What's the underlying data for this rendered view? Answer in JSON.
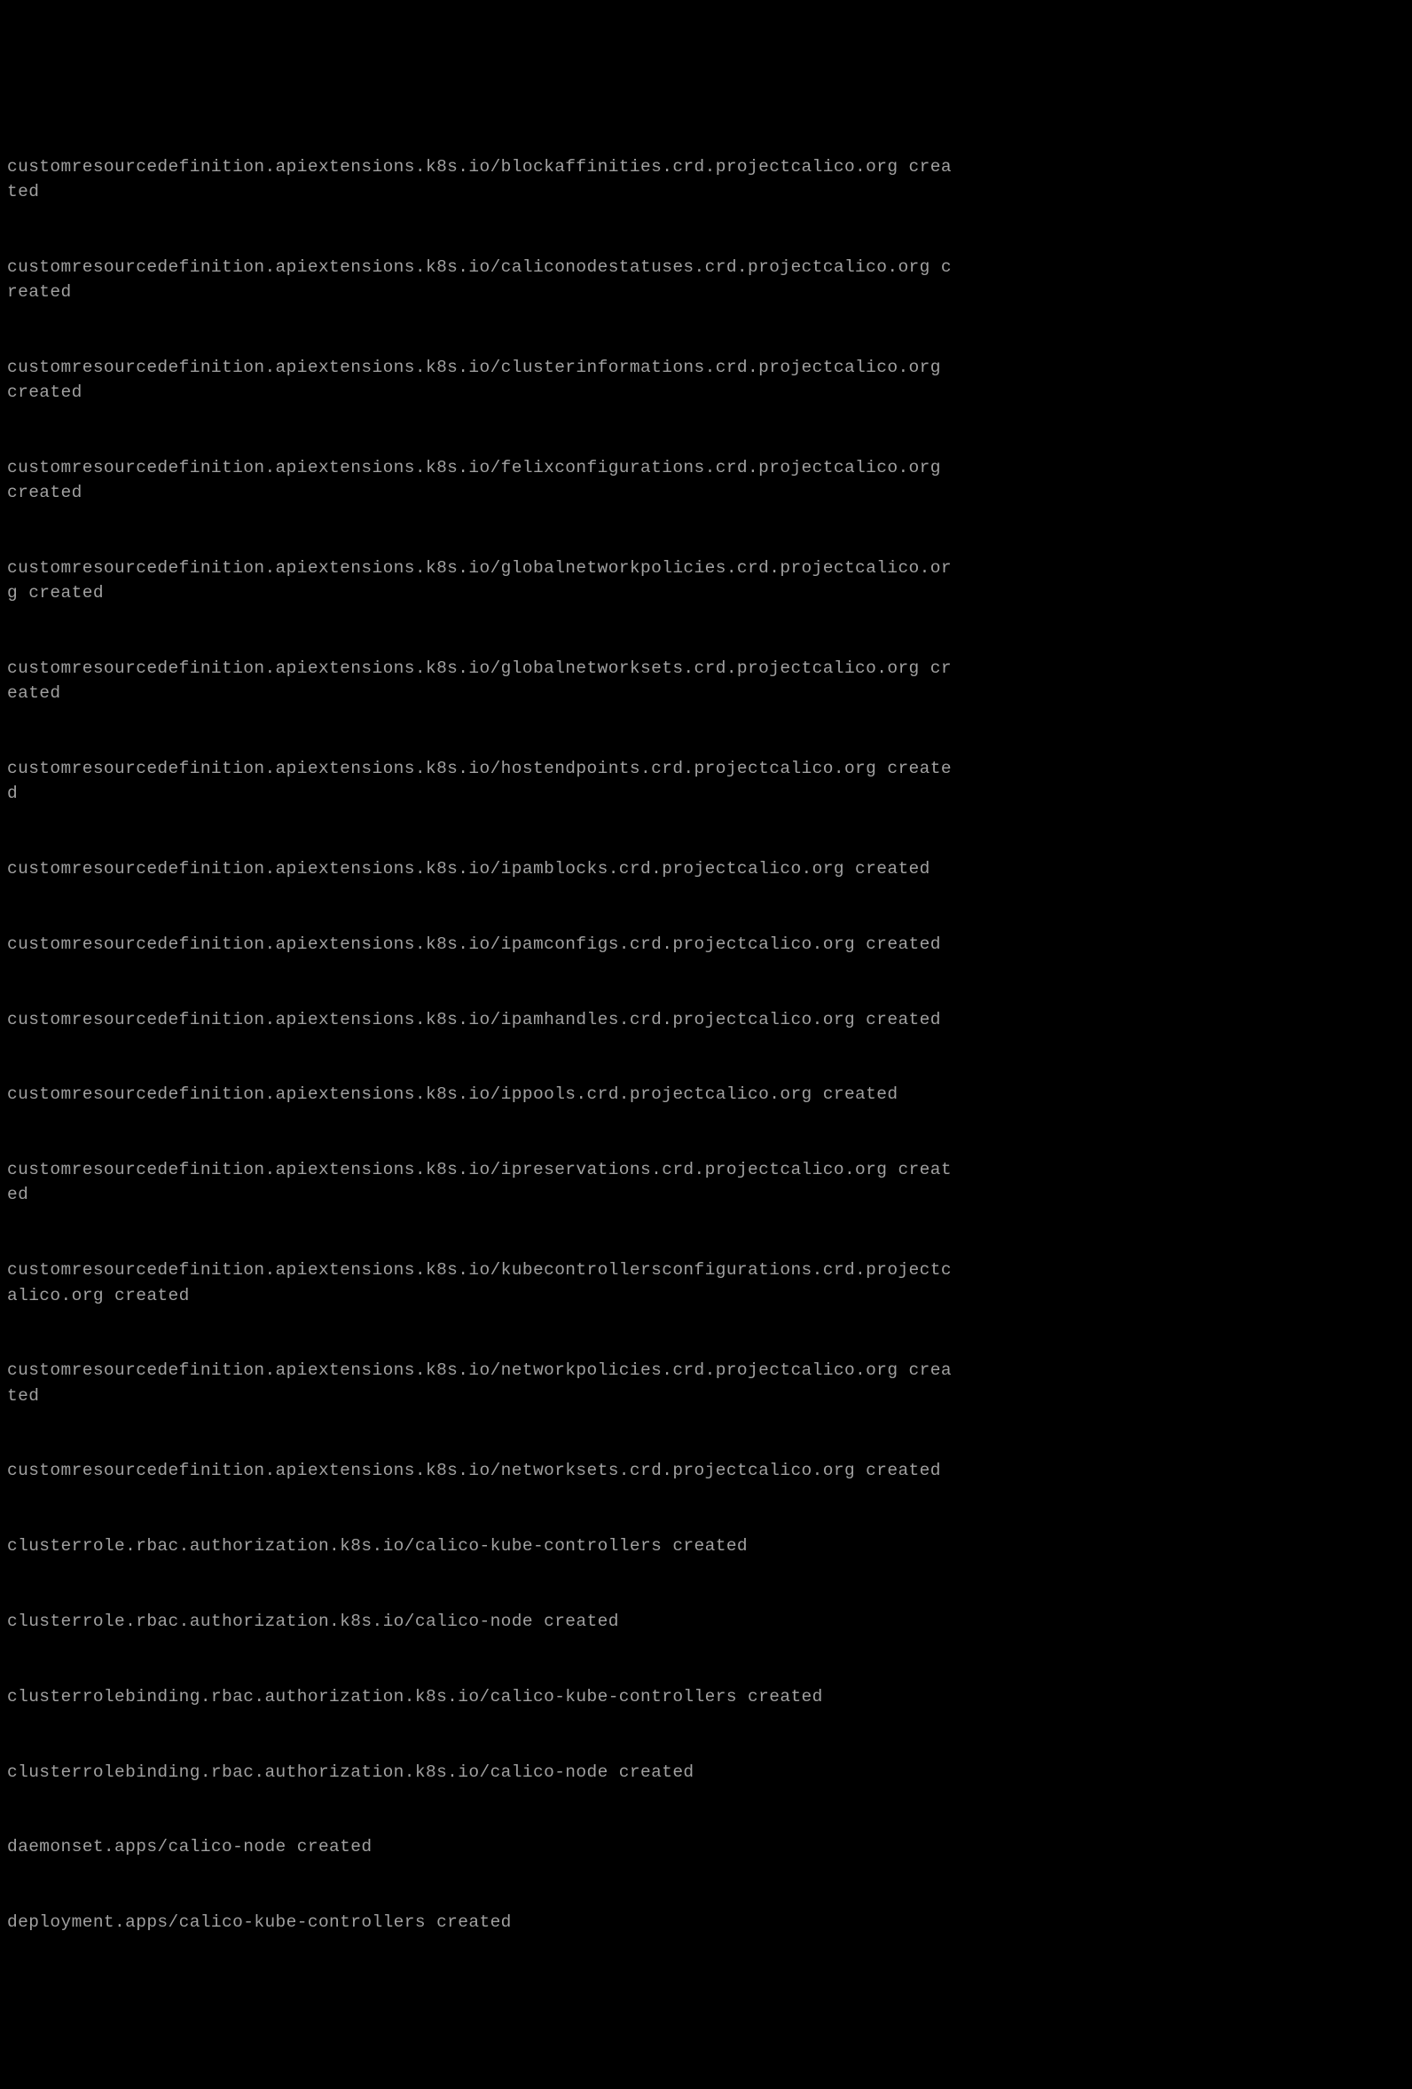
{
  "terminal": {
    "lines": [
      "customresourcedefinition.apiextensions.k8s.io/blockaffinities.crd.projectcalico.org created",
      "customresourcedefinition.apiextensions.k8s.io/caliconodestatuses.crd.projectcalico.org created",
      "customresourcedefinition.apiextensions.k8s.io/clusterinformations.crd.projectcalico.org created",
      "customresourcedefinition.apiextensions.k8s.io/felixconfigurations.crd.projectcalico.org created",
      "customresourcedefinition.apiextensions.k8s.io/globalnetworkpolicies.crd.projectcalico.org created",
      "customresourcedefinition.apiextensions.k8s.io/globalnetworksets.crd.projectcalico.org created",
      "customresourcedefinition.apiextensions.k8s.io/hostendpoints.crd.projectcalico.org created",
      "customresourcedefinition.apiextensions.k8s.io/ipamblocks.crd.projectcalico.org created",
      "customresourcedefinition.apiextensions.k8s.io/ipamconfigs.crd.projectcalico.org created",
      "customresourcedefinition.apiextensions.k8s.io/ipamhandles.crd.projectcalico.org created",
      "customresourcedefinition.apiextensions.k8s.io/ippools.crd.projectcalico.org created",
      "customresourcedefinition.apiextensions.k8s.io/ipreservations.crd.projectcalico.org created",
      "customresourcedefinition.apiextensions.k8s.io/kubecontrollersconfigurations.crd.projectcalico.org created",
      "customresourcedefinition.apiextensions.k8s.io/networkpolicies.crd.projectcalico.org created",
      "customresourcedefinition.apiextensions.k8s.io/networksets.crd.projectcalico.org created",
      "clusterrole.rbac.authorization.k8s.io/calico-kube-controllers created",
      "clusterrole.rbac.authorization.k8s.io/calico-node created",
      "clusterrolebinding.rbac.authorization.k8s.io/calico-kube-controllers created",
      "clusterrolebinding.rbac.authorization.k8s.io/calico-node created",
      "daemonset.apps/calico-node created",
      "deployment.apps/calico-kube-controllers created"
    ]
  }
}
